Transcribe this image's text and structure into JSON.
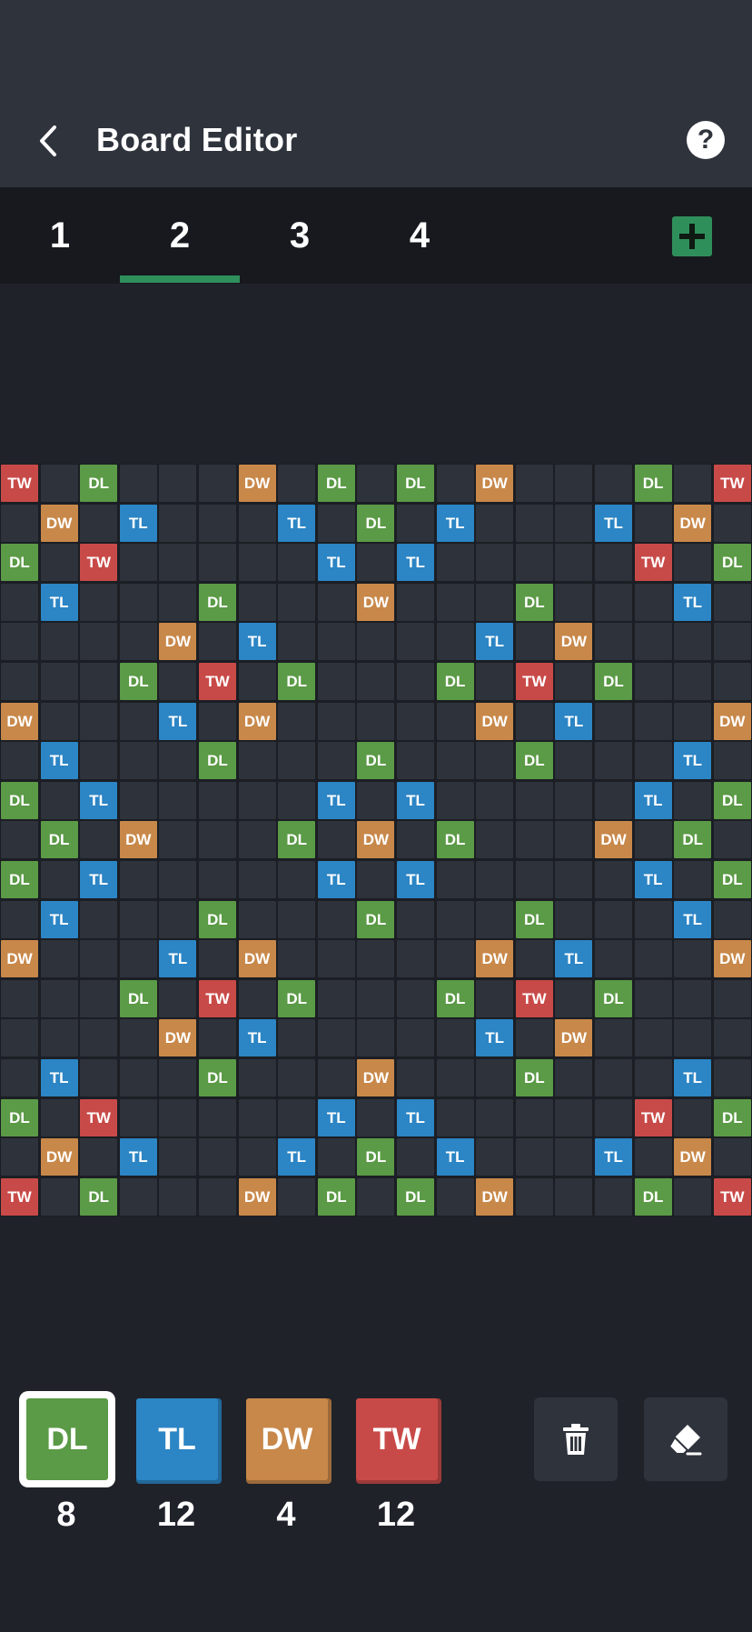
{
  "header": {
    "title": "Board Editor",
    "help_label": "?"
  },
  "tabs": [
    {
      "label": "1",
      "active": false
    },
    {
      "label": "2",
      "active": true
    },
    {
      "label": "3",
      "active": false
    },
    {
      "label": "4",
      "active": false
    }
  ],
  "board": {
    "size": 19,
    "rows": [
      "TW  DL    DW  DL  DL  DW    DL  TW",
      "  DW  TL    TL  DL  TL    TL  DW  ",
      "DL  TW        TL  TL        TW  DL",
      "  TL      DL      DW      DL    TL  ",
      "        DW  TL          TL  DW        ",
      "      DL  TW  DL      DL  TW  DL      ",
      "DW      TL  DW          DW  TL      DW",
      "  TL      DL      DL      DL      TL  ",
      "DL  TL        TL  TL        TL  DL",
      "  DL  DW    DL  DW  DL    DW  DL  ",
      "DL  TL        TL  TL        TL  DL",
      "  TL      DL      DL      DL      TL  ",
      "DW      TL  DW          DW  TL      DW",
      "      DL  TW  DL      DL  TW  DL      ",
      "        DW  TL          TL  DW        ",
      "  TL      DL      DW      DL      TL  ",
      "DL  TW        TL  TL        TW  DL",
      "  DW  TL    TL  DL  TL    TL  DW  ",
      "TW  DL    DW  DL  DL  DW    DL  TW"
    ],
    "grid": [
      [
        "TW",
        "",
        "DL",
        "",
        "",
        "",
        "DW",
        "",
        "DL",
        "",
        "DL",
        "",
        "DW",
        "",
        "",
        "",
        "DL",
        "",
        "TW"
      ],
      [
        "",
        "DW",
        "",
        "TL",
        "",
        "",
        "",
        "TL",
        "",
        "DL",
        "",
        "TL",
        "",
        "",
        "",
        "TL",
        "",
        "DW",
        ""
      ],
      [
        "DL",
        "",
        "TW",
        "",
        "",
        "",
        "",
        "",
        "TL",
        "",
        "TL",
        "",
        "",
        "",
        "",
        "",
        "TW",
        "",
        "DL"
      ],
      [
        "",
        "TL",
        "",
        "",
        "",
        "DL",
        "",
        "",
        "",
        "DW",
        "",
        "",
        "",
        "DL",
        "",
        "",
        "",
        "TL",
        ""
      ],
      [
        "",
        "",
        "",
        "",
        "DW",
        "",
        "TL",
        "",
        "",
        "",
        "",
        "",
        "TL",
        "",
        "DW",
        "",
        "",
        "",
        ""
      ],
      [
        "",
        "",
        "",
        "DL",
        "",
        "TW",
        "",
        "DL",
        "",
        "",
        "",
        "DL",
        "",
        "TW",
        "",
        "DL",
        "",
        "",
        ""
      ],
      [
        "DW",
        "",
        "",
        "",
        "TL",
        "",
        "DW",
        "",
        "",
        "",
        "",
        "",
        "DW",
        "",
        "TL",
        "",
        "",
        "",
        "DW"
      ],
      [
        "",
        "TL",
        "",
        "",
        "",
        "DL",
        "",
        "",
        "",
        "DL",
        "",
        "",
        "",
        "DL",
        "",
        "",
        "",
        "TL",
        ""
      ],
      [
        "DL",
        "",
        "TL",
        "",
        "",
        "",
        "",
        "",
        "TL",
        "",
        "TL",
        "",
        "",
        "",
        "",
        "",
        "TL",
        "",
        "DL"
      ],
      [
        "",
        "DL",
        "",
        "DW",
        "",
        "",
        "",
        "DL",
        "",
        "DW",
        "",
        "DL",
        "",
        "",
        "",
        "DW",
        "",
        "DL",
        ""
      ],
      [
        "DL",
        "",
        "TL",
        "",
        "",
        "",
        "",
        "",
        "TL",
        "",
        "TL",
        "",
        "",
        "",
        "",
        "",
        "TL",
        "",
        "DL"
      ],
      [
        "",
        "TL",
        "",
        "",
        "",
        "DL",
        "",
        "",
        "",
        "DL",
        "",
        "",
        "",
        "DL",
        "",
        "",
        "",
        "TL",
        ""
      ],
      [
        "DW",
        "",
        "",
        "",
        "TL",
        "",
        "DW",
        "",
        "",
        "",
        "",
        "",
        "DW",
        "",
        "TL",
        "",
        "",
        "",
        "DW"
      ],
      [
        "",
        "",
        "",
        "DL",
        "",
        "TW",
        "",
        "DL",
        "",
        "",
        "",
        "DL",
        "",
        "TW",
        "",
        "DL",
        "",
        "",
        ""
      ],
      [
        "",
        "",
        "",
        "",
        "DW",
        "",
        "TL",
        "",
        "",
        "",
        "",
        "",
        "TL",
        "",
        "DW",
        "",
        "",
        "",
        ""
      ],
      [
        "",
        "TL",
        "",
        "",
        "",
        "DL",
        "",
        "",
        "",
        "DW",
        "",
        "",
        "",
        "DL",
        "",
        "",
        "",
        "TL",
        ""
      ],
      [
        "DL",
        "",
        "TW",
        "",
        "",
        "",
        "",
        "",
        "TL",
        "",
        "TL",
        "",
        "",
        "",
        "",
        "",
        "TW",
        "",
        "DL"
      ],
      [
        "",
        "DW",
        "",
        "TL",
        "",
        "",
        "",
        "TL",
        "",
        "DL",
        "",
        "TL",
        "",
        "",
        "",
        "TL",
        "",
        "DW",
        ""
      ],
      [
        "TW",
        "",
        "DL",
        "",
        "",
        "",
        "DW",
        "",
        "DL",
        "",
        "DL",
        "",
        "DW",
        "",
        "",
        "",
        "DL",
        "",
        "TW"
      ]
    ]
  },
  "palette": [
    {
      "label": "DL",
      "count": "8",
      "color": "#5b9a46",
      "selected": true
    },
    {
      "label": "TL",
      "count": "12",
      "color": "#2c85c4",
      "selected": false
    },
    {
      "label": "DW",
      "count": "4",
      "color": "#c8884a",
      "selected": false
    },
    {
      "label": "TW",
      "count": "12",
      "color": "#c84a48",
      "selected": false
    }
  ],
  "tools": [
    {
      "name": "trash-icon"
    },
    {
      "name": "eraser-icon"
    }
  ],
  "colors": {
    "DL": "#5b9a46",
    "TL": "#2c85c4",
    "DW": "#c8884a",
    "TW": "#c84a48",
    "accent": "#2f8f5b",
    "empty_cell": "#2e323b"
  }
}
